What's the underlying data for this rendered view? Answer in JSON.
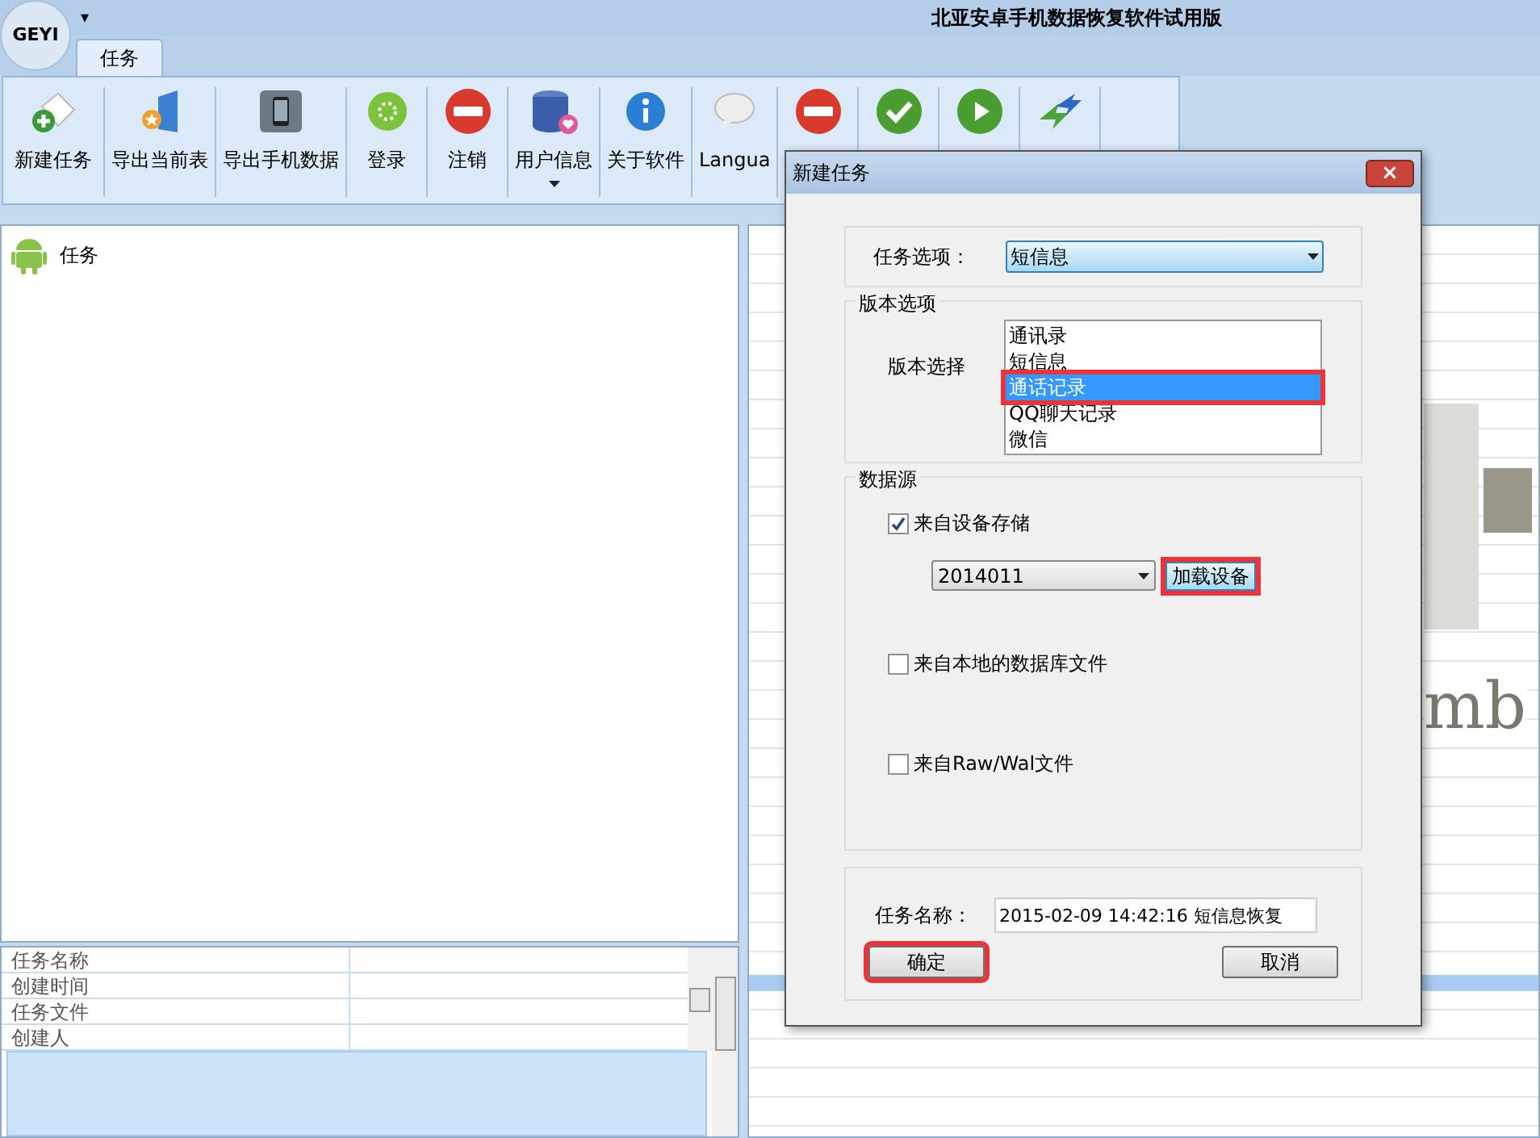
{
  "window": {
    "logo_text": "GEYI",
    "quick_access_caret": "▾",
    "title": "北亚安卓手机数据恢复软件试用版"
  },
  "tabs": [
    {
      "label": "任务",
      "selected": true
    }
  ],
  "toolbar": [
    {
      "label": "新建任务"
    },
    {
      "label": "导出当前表"
    },
    {
      "label": "导出手机数据"
    },
    {
      "label": "登录"
    },
    {
      "label": "注销"
    },
    {
      "label": "用户信息",
      "dropdown": true
    },
    {
      "label": "关于软件"
    },
    {
      "label": "Langua"
    }
  ],
  "tree": {
    "items": [
      {
        "label": "任务"
      }
    ]
  },
  "properties": {
    "rows": [
      {
        "name": "任务名称"
      },
      {
        "name": "创建时间"
      },
      {
        "name": "任务文件"
      },
      {
        "name": "创建人"
      }
    ]
  },
  "background_logo": {
    "text": "mb"
  },
  "dialog": {
    "title": "新建任务",
    "close": "×",
    "task_option": {
      "label": "任务选项：",
      "value": "短信息",
      "options": [
        {
          "label": "通讯录",
          "highlighted": false,
          "annotated": false
        },
        {
          "label": "短信息",
          "highlighted": false,
          "annotated": false
        },
        {
          "label": "通话记录",
          "highlighted": true,
          "annotated": true
        },
        {
          "label": "QQ聊天记录",
          "highlighted": false,
          "annotated": false
        },
        {
          "label": "微信",
          "highlighted": false,
          "annotated": false
        }
      ]
    },
    "version_group": {
      "title": "版本选项",
      "label": "版本选择"
    },
    "source_group": {
      "title": "数据源",
      "sources": [
        {
          "label": "来自设备存储",
          "checked": true
        },
        {
          "label": "来自本地的数据库文件",
          "checked": false
        },
        {
          "label": "来自Raw/Wal文件",
          "checked": false
        }
      ],
      "device": "2014011",
      "load_button": {
        "label": "加载设备",
        "annotated": true
      }
    },
    "task_name": {
      "label": "任务名称：",
      "value": "2015-02-09 14:42:16 短信息恢复"
    },
    "buttons": [
      {
        "label": "确定",
        "annotated": true
      },
      {
        "label": "取消",
        "annotated": false
      }
    ]
  }
}
